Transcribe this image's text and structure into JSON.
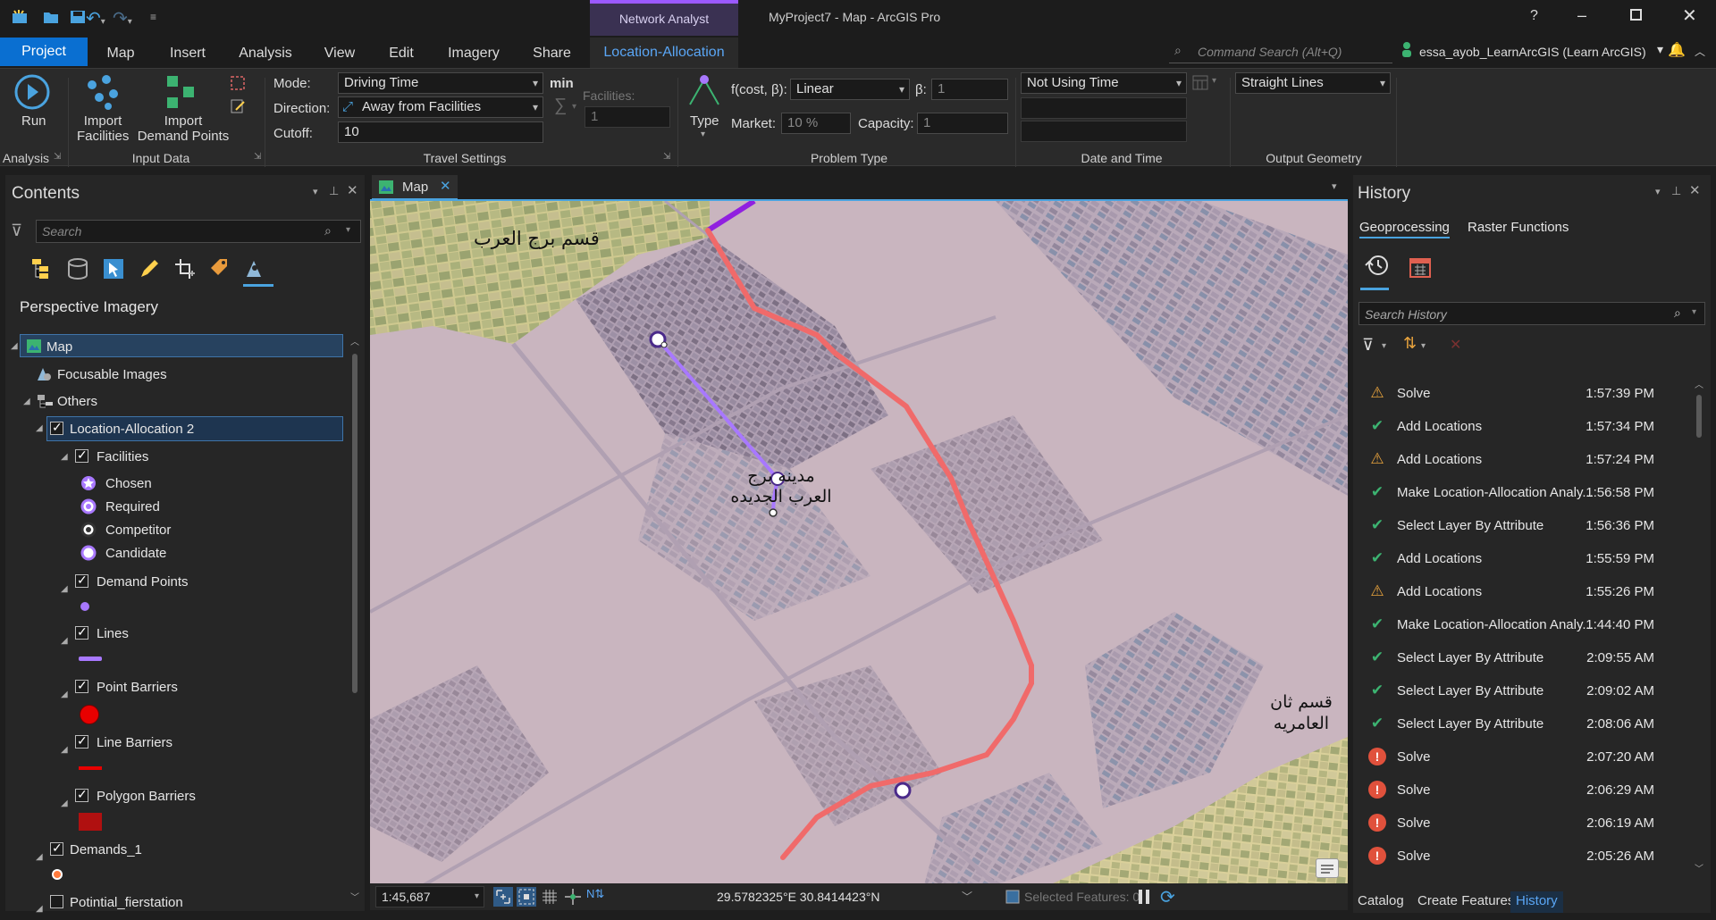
{
  "title": {
    "context_tab": "Network Analyst",
    "window_title": "MyProject7 - Map - ArcGIS Pro",
    "help": "?"
  },
  "tabs": [
    {
      "label": "Project"
    },
    {
      "label": "Map"
    },
    {
      "label": "Insert"
    },
    {
      "label": "Analysis"
    },
    {
      "label": "View"
    },
    {
      "label": "Edit"
    },
    {
      "label": "Imagery"
    },
    {
      "label": "Share"
    },
    {
      "label": "Location-Allocation"
    }
  ],
  "search": {
    "placeholder": "Command Search (Alt+Q)"
  },
  "user": {
    "name": "essa_ayob_LearnArcGIS (Learn ArcGIS)"
  },
  "ribbon": {
    "run_label": "Run",
    "import_facilities": [
      "Import",
      "Facilities"
    ],
    "import_demand": [
      "Import",
      "Demand Points"
    ],
    "group_analysis": "Analysis",
    "group_input": "Input Data",
    "group_travel": "Travel Settings",
    "group_problem": "Problem Type",
    "group_date": "Date and Time",
    "group_output": "Output Geometry",
    "mode_label": "Mode:",
    "mode_value": "Driving Time",
    "mode_unit": "min",
    "direction_label": "Direction:",
    "direction_value": "Away from Facilities",
    "cutoff_label": "Cutoff:",
    "cutoff_value": "10",
    "facilities_label": "Facilities:",
    "facilities_value": "1",
    "type_label": "Type",
    "fcost_label": "f(cost, β):",
    "fcost_value": "Linear",
    "beta_label": "β:",
    "beta_value": "1",
    "market_label": "Market:",
    "market_value": "10  %",
    "capacity_label": "Capacity:",
    "capacity_value": "1",
    "date_value": "Not Using Time",
    "output_value": "Straight Lines"
  },
  "contents": {
    "title": "Contents",
    "search_placeholder": "Search",
    "section": "Perspective Imagery",
    "items": {
      "map": "Map",
      "focusable": "Focusable Images",
      "others": "Others",
      "la2": "Location-Allocation 2",
      "facilities": "Facilities",
      "chosen": "Chosen",
      "required": "Required",
      "competitor": "Competitor",
      "candidate": "Candidate",
      "demand": "Demand Points",
      "lines": "Lines",
      "point_barriers": "Point Barriers",
      "line_barriers": "Line Barriers",
      "polygon_barriers": "Polygon Barriers",
      "demands1": "Demands_1",
      "potential": "Potintial_fierstation"
    }
  },
  "map": {
    "tab": "Map",
    "labels": {
      "burg_arab": "قسم برج العرب",
      "new_city_1": "مدينه برج",
      "new_city_2": "العرب الجديده",
      "amreya_1": "قسم ثان",
      "amreya_2": "العامريه"
    },
    "scale": "1:45,687",
    "coords": "29.5782325°E 30.8414423°N",
    "selected": "Selected Features: 0"
  },
  "history": {
    "title": "History",
    "tab1": "Geoprocessing",
    "tab2": "Raster Functions",
    "search_placeholder": "Search History",
    "rows": [
      {
        "status": "warning",
        "name": "Solve",
        "time": "1:57:39 PM"
      },
      {
        "status": "success",
        "name": "Add Locations",
        "time": "1:57:34 PM"
      },
      {
        "status": "warning",
        "name": "Add Locations",
        "time": "1:57:24 PM"
      },
      {
        "status": "success",
        "name": "Make Location-Allocation Analy...",
        "time": "1:56:58 PM"
      },
      {
        "status": "success",
        "name": "Select Layer By Attribute",
        "time": "1:56:36 PM"
      },
      {
        "status": "success",
        "name": "Add Locations",
        "time": "1:55:59 PM"
      },
      {
        "status": "warning",
        "name": "Add Locations",
        "time": "1:55:26 PM"
      },
      {
        "status": "success",
        "name": "Make Location-Allocation Analy...",
        "time": "1:44:40 PM"
      },
      {
        "status": "success",
        "name": "Select Layer By Attribute",
        "time": "2:09:55 AM"
      },
      {
        "status": "success",
        "name": "Select Layer By Attribute",
        "time": "2:09:02 AM"
      },
      {
        "status": "success",
        "name": "Select Layer By Attribute",
        "time": "2:08:06 AM"
      },
      {
        "status": "error",
        "name": "Solve",
        "time": "2:07:20 AM"
      },
      {
        "status": "error",
        "name": "Solve",
        "time": "2:06:29 AM"
      },
      {
        "status": "error",
        "name": "Solve",
        "time": "2:06:19 AM"
      },
      {
        "status": "error",
        "name": "Solve",
        "time": "2:05:26 AM"
      }
    ],
    "bottom_tabs": [
      "Catalog",
      "Create Features",
      "History"
    ]
  },
  "colors": {
    "accent": "#0a6fd1",
    "warning": "#e8a33d",
    "success": "#3cb371",
    "error": "#e0513c",
    "route": "#f06a6a",
    "line": "#a878ff"
  }
}
